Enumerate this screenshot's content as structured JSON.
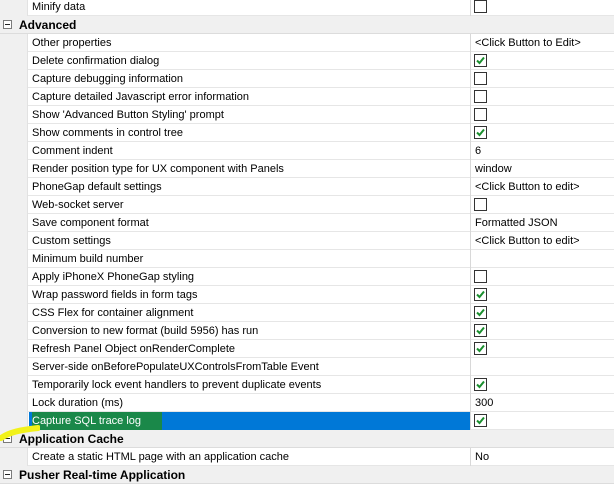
{
  "rows": [
    {
      "kind": "prop",
      "name": "Minify data",
      "type": "checkbox",
      "checked": false
    },
    {
      "kind": "category",
      "name": "Advanced"
    },
    {
      "kind": "prop",
      "name": "Other properties",
      "type": "text",
      "value": "<Click Button to Edit>"
    },
    {
      "kind": "prop",
      "name": "Delete confirmation dialog",
      "type": "checkbox",
      "checked": true
    },
    {
      "kind": "prop",
      "name": "Capture debugging information",
      "type": "checkbox",
      "checked": false
    },
    {
      "kind": "prop",
      "name": "Capture detailed Javascript error information",
      "type": "checkbox",
      "checked": false
    },
    {
      "kind": "prop",
      "name": "Show 'Advanced Button Styling' prompt",
      "type": "checkbox",
      "checked": false
    },
    {
      "kind": "prop",
      "name": "Show comments in control tree",
      "type": "checkbox",
      "checked": true
    },
    {
      "kind": "prop",
      "name": "Comment indent",
      "type": "text",
      "value": "6"
    },
    {
      "kind": "prop",
      "name": "Render position type for UX component with Panels",
      "type": "text",
      "value": "window"
    },
    {
      "kind": "prop",
      "name": "PhoneGap default settings",
      "type": "text",
      "value": "<Click Button to edit>"
    },
    {
      "kind": "prop",
      "name": "Web-socket server",
      "type": "checkbox",
      "checked": false
    },
    {
      "kind": "prop",
      "name": "Save component format",
      "type": "text",
      "value": "Formatted JSON"
    },
    {
      "kind": "prop",
      "name": "Custom settings",
      "type": "text",
      "value": "<Click Button to edit>"
    },
    {
      "kind": "prop",
      "name": "Minimum build number",
      "type": "text",
      "value": ""
    },
    {
      "kind": "prop",
      "name": "Apply iPhoneX PhoneGap styling",
      "type": "checkbox",
      "checked": false
    },
    {
      "kind": "prop",
      "name": "Wrap password fields in form tags",
      "type": "checkbox",
      "checked": true
    },
    {
      "kind": "prop",
      "name": "CSS Flex for container alignment",
      "type": "checkbox",
      "checked": true
    },
    {
      "kind": "prop",
      "name": "Conversion to new format (build 5956) has run",
      "type": "checkbox",
      "checked": true
    },
    {
      "kind": "prop",
      "name": "Refresh Panel Object onRenderComplete",
      "type": "checkbox",
      "checked": true
    },
    {
      "kind": "prop",
      "name": "Server-side onBeforePopulateUXControlsFromTable Event",
      "type": "text",
      "value": ""
    },
    {
      "kind": "prop",
      "name": "Temporarily lock event handlers to prevent duplicate events",
      "type": "checkbox",
      "checked": true
    },
    {
      "kind": "prop",
      "name": "Lock duration (ms)",
      "type": "text",
      "value": "300"
    },
    {
      "kind": "prop",
      "name": "Capture SQL trace log",
      "type": "checkbox",
      "checked": true,
      "selected": true
    },
    {
      "kind": "category",
      "name": "Application Cache"
    },
    {
      "kind": "prop",
      "name": "Create a static HTML page with an application cache",
      "type": "text",
      "value": "No"
    },
    {
      "kind": "category",
      "name": "Pusher Real-time Application"
    }
  ],
  "colors": {
    "selection": "#0078d7",
    "highlight_marker": "#1d8a3a",
    "check_mark": "#1a8f2e",
    "annotation": "#f2f21a"
  },
  "icons": {
    "expander": "collapse-minus-icon",
    "check": "checkmark-icon"
  }
}
